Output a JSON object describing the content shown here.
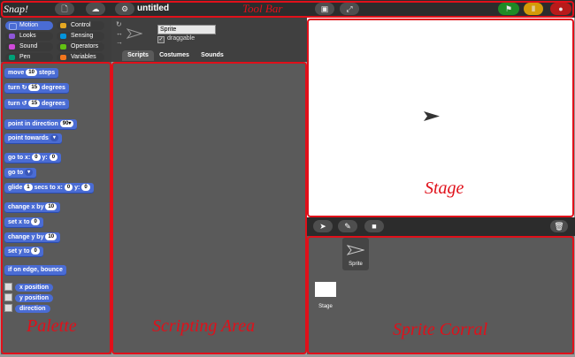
{
  "toolbar": {
    "logo_text": "Snap!",
    "project_title": "untitled",
    "annotation": "Tool Bar",
    "icons": [
      "file-icon",
      "cloud-icon",
      "gear-icon",
      "stage-size-icon",
      "fullscreen-icon",
      "green-flag-icon",
      "pause-icon",
      "stop-icon"
    ],
    "colors": {
      "green_flag": "#1f8a25",
      "pause": "#d49b08",
      "stop": "#b81a1a"
    }
  },
  "palette": {
    "categories": [
      {
        "label": "Motion",
        "color": "#4a6cd4",
        "selected": true
      },
      {
        "label": "Control",
        "color": "#e6a822",
        "selected": false
      },
      {
        "label": "Looks",
        "color": "#8f57d9",
        "selected": false
      },
      {
        "label": "Sensing",
        "color": "#0494dc",
        "selected": false
      },
      {
        "label": "Sound",
        "color": "#cf4ad9",
        "selected": false
      },
      {
        "label": "Operators",
        "color": "#62c213",
        "selected": false
      },
      {
        "label": "Pen",
        "color": "#00a178",
        "selected": false
      },
      {
        "label": "Variables",
        "color": "#f3761d",
        "selected": false
      }
    ],
    "blocks": {
      "move": {
        "pre": "move",
        "val": "10",
        "post": "steps"
      },
      "turn_cw": {
        "pre": "turn",
        "val": "15",
        "post": "degrees"
      },
      "turn_ccw": {
        "pre": "turn",
        "val": "15",
        "post": "degrees"
      },
      "point_dir": {
        "pre": "point in direction",
        "val": "90"
      },
      "point_towards": {
        "pre": "point towards"
      },
      "go_to_xy": {
        "pre": "go to x:",
        "x": "0",
        "mid": "y:",
        "y": "0"
      },
      "go_to": {
        "pre": "go to"
      },
      "glide": {
        "pre": "glide",
        "secs": "1",
        "mid1": "secs to x:",
        "x": "0",
        "mid2": "y:",
        "y": "0"
      },
      "change_x": {
        "pre": "change x by",
        "val": "10"
      },
      "set_x": {
        "pre": "set x to",
        "val": "0"
      },
      "change_y": {
        "pre": "change y by",
        "val": "10"
      },
      "set_y": {
        "pre": "set y to",
        "val": "0"
      },
      "bounce": {
        "pre": "if on edge, bounce"
      }
    },
    "reporters": [
      "x position",
      "y position",
      "direction"
    ],
    "annotation": "Palette"
  },
  "sprite_bar": {
    "name": "Sprite",
    "draggable_label": "draggable",
    "tabs": [
      "Scripts",
      "Costumes",
      "Sounds"
    ]
  },
  "scripting": {
    "annotation": "Scripting Area"
  },
  "stage": {
    "annotation": "Stage"
  },
  "corral": {
    "sprite_label": "Sprite",
    "stage_label": "Stage",
    "annotation": "Sprite Corral"
  },
  "annotation_color": "#e0101a"
}
